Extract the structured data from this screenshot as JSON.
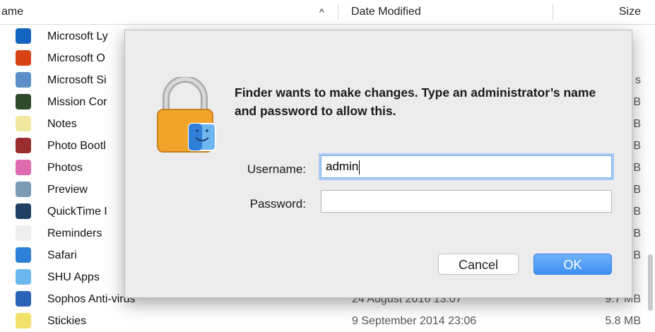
{
  "header": {
    "name_label": "ame",
    "sort_indicator": "^",
    "date_label": "Date Modified",
    "size_label": "Size"
  },
  "files": [
    {
      "name": "Microsoft Ly",
      "date": "",
      "size": "",
      "icon": "lync-icon",
      "color": "#1565c0"
    },
    {
      "name": "Microsoft O",
      "date": "",
      "size": "",
      "icon": "office-icon",
      "color": "#d84315"
    },
    {
      "name": "Microsoft Si",
      "date": "",
      "size": "s",
      "icon": "silverlight-icon",
      "color": "#5c8fc7"
    },
    {
      "name": "Mission Cor",
      "date": "",
      "size": "B",
      "icon": "mission-control-icon",
      "color": "#2e4a2a"
    },
    {
      "name": "Notes",
      "date": "",
      "size": "B",
      "icon": "notes-icon",
      "color": "#f3e7a0"
    },
    {
      "name": "Photo Bootl",
      "date": "",
      "size": "B",
      "icon": "photo-booth-icon",
      "color": "#9b2d2d"
    },
    {
      "name": "Photos",
      "date": "",
      "size": "B",
      "icon": "photos-icon",
      "color": "#e06bb0"
    },
    {
      "name": "Preview",
      "date": "",
      "size": "B",
      "icon": "preview-icon",
      "color": "#7c9bb5"
    },
    {
      "name": "QuickTime I",
      "date": "",
      "size": "B",
      "icon": "quicktime-icon",
      "color": "#1f3f63"
    },
    {
      "name": "Reminders",
      "date": "",
      "size": "B",
      "icon": "reminders-icon",
      "color": "#eeeeee"
    },
    {
      "name": "Safari",
      "date": "",
      "size": "B",
      "icon": "safari-icon",
      "color": "#2f80d8"
    },
    {
      "name": "SHU Apps",
      "date": "",
      "size": "",
      "icon": "folder-icon",
      "color": "#6cb8ee"
    },
    {
      "name": "Sophos Anti-virus",
      "date": "24 August 2016 13:07",
      "size": "9.7 MB",
      "icon": "sophos-icon",
      "color": "#2b63b8"
    },
    {
      "name": "Stickies",
      "date": "9 September 2014 23:06",
      "size": "5.8 MB",
      "icon": "stickies-icon",
      "color": "#f2e26b"
    }
  ],
  "dialog": {
    "message": "Finder wants to make changes. Type an administrator’s name and password to allow this.",
    "username_label": "Username:",
    "username_value": "admin",
    "password_label": "Password:",
    "password_value": "",
    "cancel_label": "Cancel",
    "ok_label": "OK"
  }
}
